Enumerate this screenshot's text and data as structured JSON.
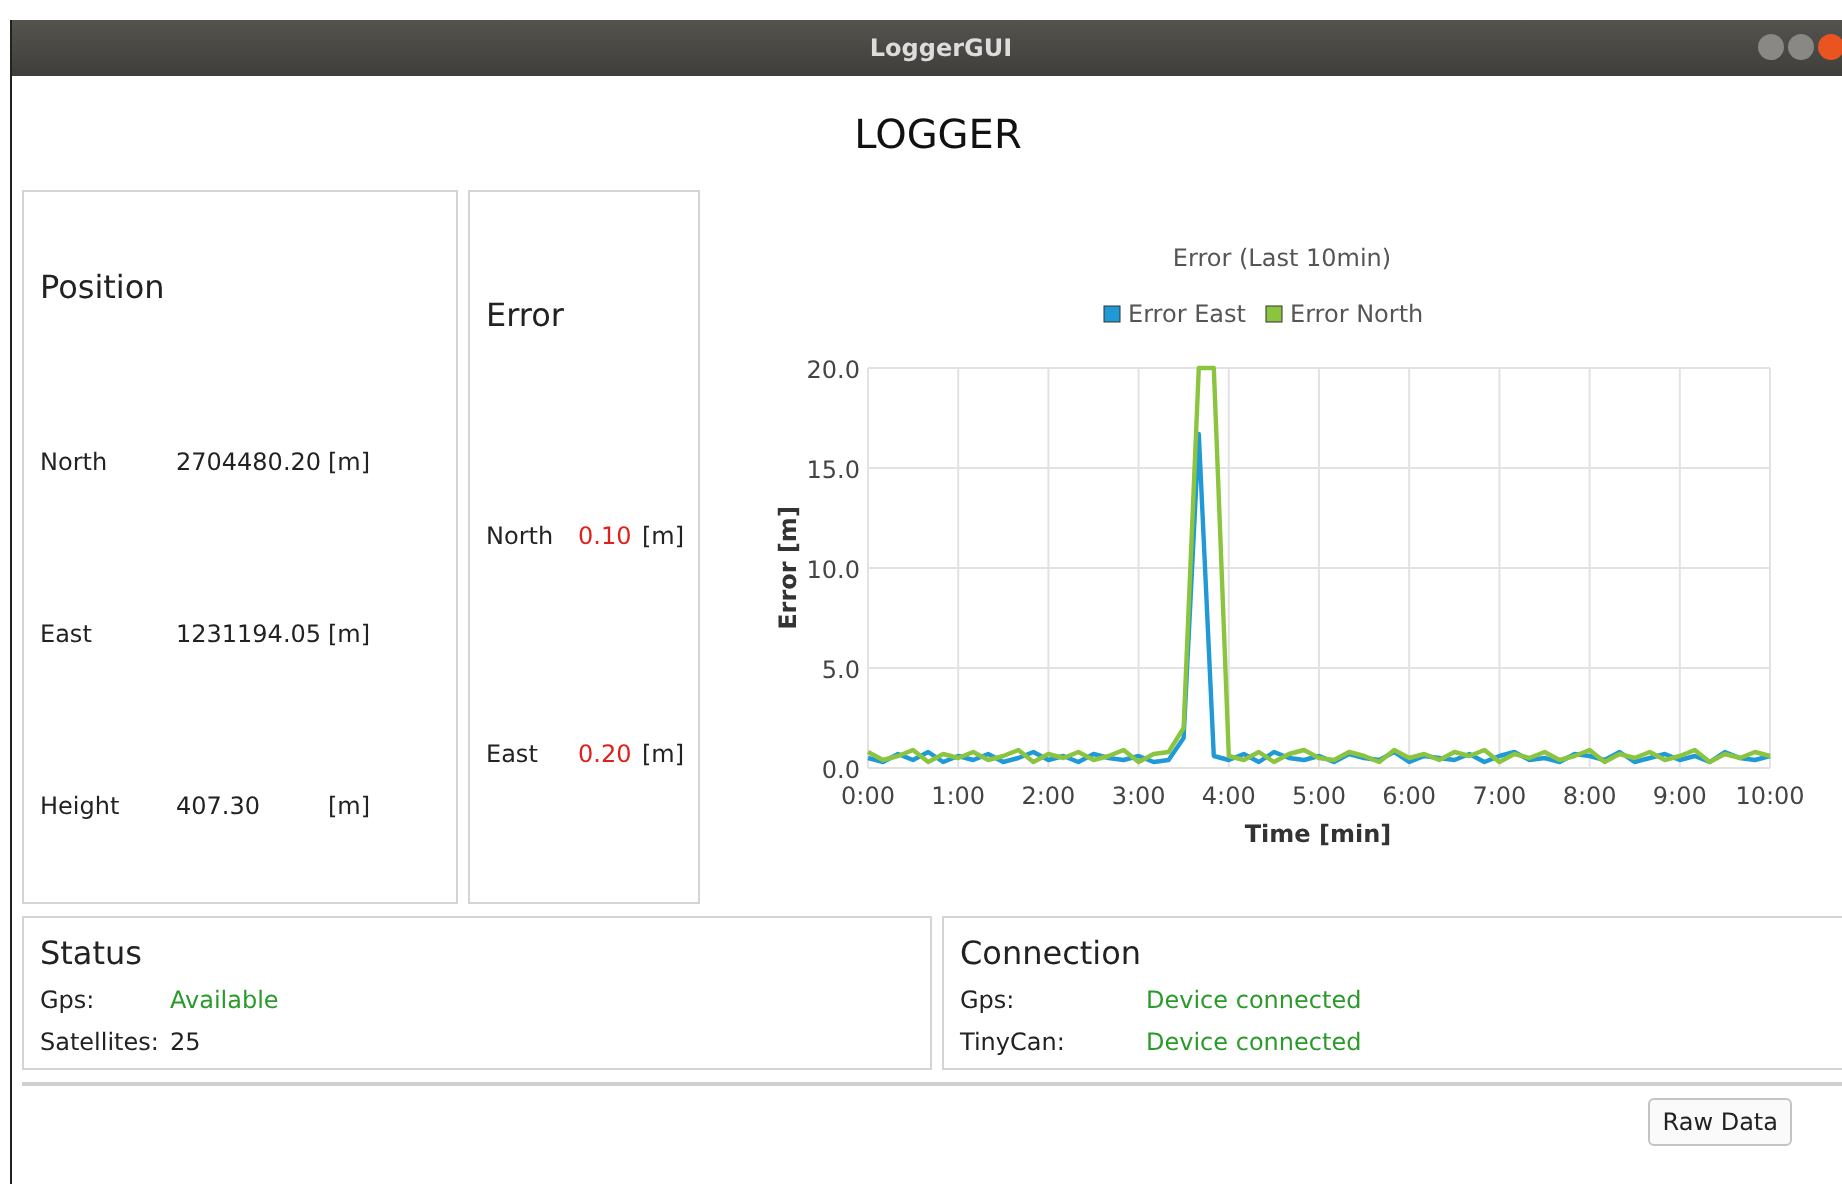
{
  "window": {
    "title": "LoggerGUI"
  },
  "heading": "LOGGER",
  "position": {
    "title": "Position",
    "rows": [
      {
        "label": "North",
        "value": "2704480.20",
        "unit": "[m]"
      },
      {
        "label": "East",
        "value": "1231194.05",
        "unit": "[m]"
      },
      {
        "label": "Height",
        "value": "407.30",
        "unit": "[m]"
      }
    ]
  },
  "error": {
    "title": "Error",
    "rows": [
      {
        "label": "North",
        "value": "0.10",
        "unit": "[m]"
      },
      {
        "label": "East",
        "value": "0.20",
        "unit": "[m]"
      }
    ]
  },
  "chart": {
    "chart_data": {
      "type": "line",
      "title": "Error (Last 10min)",
      "xlabel": "Time [min]",
      "ylabel": "Error [m]",
      "x": [
        0,
        10,
        20,
        30,
        40,
        50,
        60,
        70,
        80,
        90,
        100,
        110,
        120,
        130,
        140,
        150,
        160,
        170,
        180,
        190,
        200,
        210,
        220,
        230,
        240,
        250,
        260,
        270,
        280,
        290,
        300,
        310,
        320,
        330,
        340,
        350,
        360,
        370,
        380,
        390,
        400,
        410,
        420,
        430,
        440,
        450,
        460,
        470,
        480,
        490,
        500,
        510,
        520,
        530,
        540,
        550,
        560,
        570,
        580,
        590,
        600
      ],
      "series": [
        {
          "name": "Error East",
          "color": "#1f9ad6",
          "values": [
            0.5,
            0.3,
            0.7,
            0.4,
            0.8,
            0.3,
            0.6,
            0.4,
            0.7,
            0.3,
            0.5,
            0.8,
            0.4,
            0.6,
            0.3,
            0.7,
            0.5,
            0.4,
            0.6,
            0.3,
            0.4,
            1.5,
            16.7,
            0.6,
            0.4,
            0.7,
            0.3,
            0.8,
            0.5,
            0.4,
            0.6,
            0.3,
            0.7,
            0.5,
            0.4,
            0.8,
            0.3,
            0.6,
            0.5,
            0.4,
            0.7,
            0.3,
            0.6,
            0.8,
            0.4,
            0.5,
            0.3,
            0.7,
            0.6,
            0.4,
            0.8,
            0.3,
            0.5,
            0.7,
            0.4,
            0.6,
            0.3,
            0.8,
            0.5,
            0.4,
            0.6
          ]
        },
        {
          "name": "Error North",
          "color": "#8bc43f",
          "values": [
            0.8,
            0.4,
            0.6,
            0.9,
            0.3,
            0.7,
            0.5,
            0.8,
            0.4,
            0.6,
            0.9,
            0.3,
            0.7,
            0.5,
            0.8,
            0.4,
            0.6,
            0.9,
            0.3,
            0.7,
            0.8,
            2.0,
            20.0,
            20.0,
            0.6,
            0.4,
            0.8,
            0.3,
            0.7,
            0.9,
            0.5,
            0.4,
            0.8,
            0.6,
            0.3,
            0.9,
            0.5,
            0.7,
            0.4,
            0.8,
            0.6,
            0.9,
            0.3,
            0.7,
            0.5,
            0.8,
            0.4,
            0.6,
            0.9,
            0.3,
            0.7,
            0.5,
            0.8,
            0.4,
            0.6,
            0.9,
            0.3,
            0.7,
            0.5,
            0.8,
            0.6
          ]
        }
      ],
      "xlim": [
        0,
        600
      ],
      "ylim": [
        0,
        20
      ],
      "grid": true,
      "legend": true,
      "xticks": [
        {
          "value": 0,
          "label": "0:00"
        },
        {
          "value": 60,
          "label": "1:00"
        },
        {
          "value": 120,
          "label": "2:00"
        },
        {
          "value": 180,
          "label": "3:00"
        },
        {
          "value": 240,
          "label": "4:00"
        },
        {
          "value": 300,
          "label": "5:00"
        },
        {
          "value": 360,
          "label": "6:00"
        },
        {
          "value": 420,
          "label": "7:00"
        },
        {
          "value": 480,
          "label": "8:00"
        },
        {
          "value": 540,
          "label": "9:00"
        },
        {
          "value": 600,
          "label": "10:00"
        }
      ],
      "yticks": [
        {
          "value": 0,
          "label": "0.0"
        },
        {
          "value": 5,
          "label": "5.0"
        },
        {
          "value": 10,
          "label": "10.0"
        },
        {
          "value": 15,
          "label": "15.0"
        },
        {
          "value": 20,
          "label": "20.0"
        }
      ]
    }
  },
  "status": {
    "title": "Status",
    "rows": [
      {
        "label": "Gps:",
        "value": "Available",
        "kind": "ok"
      },
      {
        "label": "Satellites:",
        "value": "25",
        "kind": "plain"
      }
    ]
  },
  "connection": {
    "title": "Connection",
    "rows": [
      {
        "label": "Gps:",
        "value": "Device connected",
        "kind": "ok"
      },
      {
        "label": "TinyCan:",
        "value": "Device connected",
        "kind": "ok"
      }
    ]
  },
  "buttons": [
    "Raw Data"
  ]
}
